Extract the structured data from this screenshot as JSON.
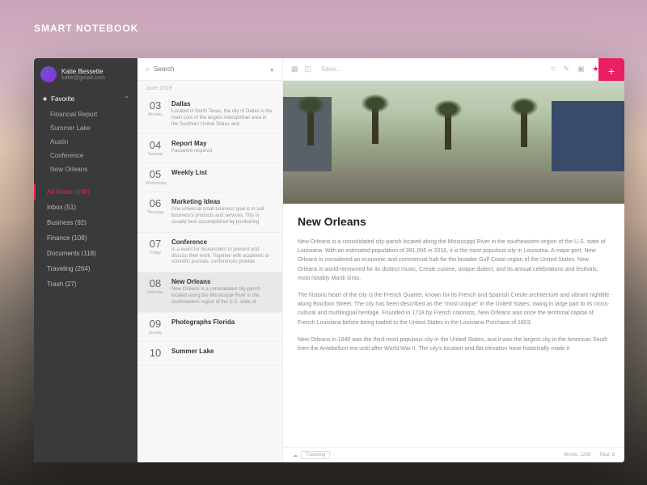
{
  "app_title": "SMART NOTEBOOK",
  "user": {
    "name": "Katie Bessette",
    "email": "katie@gmail.com"
  },
  "sidebar": {
    "favorite_label": "Favorite",
    "favorites": [
      "Financial Report",
      "Summer Lake",
      "Austin",
      "Conference",
      "New Orleans"
    ],
    "categories": [
      {
        "label": "All Notes (698)",
        "active": true
      },
      {
        "label": "Inbox (51)"
      },
      {
        "label": "Business (92)"
      },
      {
        "label": "Finance (108)"
      },
      {
        "label": "Documents (118)"
      },
      {
        "label": "Traveling (264)"
      },
      {
        "label": "Trash (27)"
      }
    ]
  },
  "search": {
    "placeholder": "Search"
  },
  "notes_month": "June 2019",
  "notes": [
    {
      "day": "03",
      "dow": "Monday",
      "title": "Dallas",
      "snip": "Located in North Texas, the city of Dallas is the main core of the largest metropolitan area in the Southern United States and"
    },
    {
      "day": "04",
      "dow": "Tuesday",
      "title": "Report May",
      "snip": "Password required"
    },
    {
      "day": "05",
      "dow": "Wednesday",
      "title": "Weekly List",
      "snip": ""
    },
    {
      "day": "06",
      "dow": "Thursday",
      "title": "Marketing Ideas",
      "snip": "One universal small business goal is to sell business's products and services. This is usually best accomplished by positioning"
    },
    {
      "day": "07",
      "dow": "Friday",
      "title": "Conference",
      "snip": "Is a event for researchers to present and discuss their work. Together with academic or scientific journals, conferences provide"
    },
    {
      "day": "08",
      "dow": "Saturday",
      "title": "New Orleans",
      "snip": "New Orleans is a consolidated city-parish located along the Mississippi River in the southeastern region of the U.S. state of",
      "selected": true
    },
    {
      "day": "09",
      "dow": "Sunday",
      "title": "Photographs Florida",
      "snip": ""
    },
    {
      "day": "10",
      "dow": "",
      "title": "Summer Lake",
      "snip": ""
    }
  ],
  "toolbar": {
    "save": "Save..."
  },
  "article": {
    "title": "New Orleans",
    "p1": "New Orleans is a consolidated city-parish located along the Mississippi River in the southeastern region of the U.S. state of Louisiana. With an estimated population of 391,006 in 2018, it is the most populous city in Louisiana. A major port, New Orleans is considered an economic and commercial hub for the broader Gulf Coast region of the United States. New Orleans is world-renowned for its distinct music, Creole cuisine, unique dialect, and its annual celebrations and festivals, most notably Mardi Gras.",
    "p2": "The historic heart of the city is the French Quarter, known for its French and Spanish Creole architecture and vibrant nightlife along Bourbon Street. The city has been described as the \"most unique\" in the United States, owing in large part to its cross-cultural and multilingual heritage. Founded in 1718 by French colonists, New Orleans was once the territorial capital of French Louisiana before being traded to the United States in the Louisiana Purchase of 1803.",
    "p3": "New Orleans in 1840 was the third-most populous city in the United States, and it was the largest city in the American South from the Antebellum era until after World War II. The city's location and flat elevation have historically made it"
  },
  "footer": {
    "tag_icon": "☁",
    "tag": "Traveling",
    "words": "Words: 1289",
    "total": "Total: 8"
  }
}
